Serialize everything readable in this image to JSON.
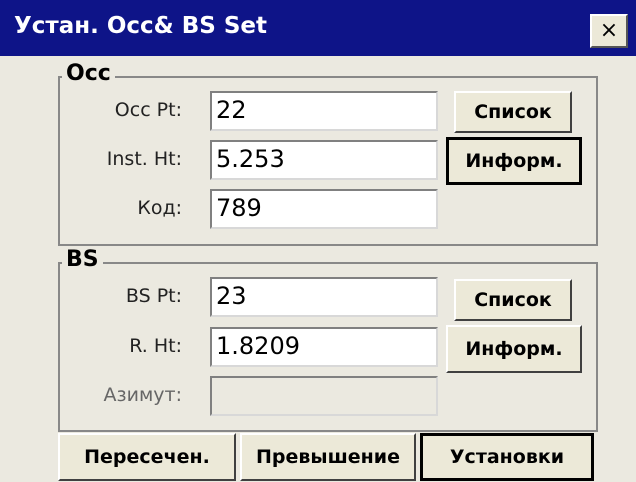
{
  "window": {
    "title": "Устан. Occ& BS Set",
    "close_label": "×"
  },
  "occ": {
    "legend": "Occ",
    "occ_pt_label": "Occ Pt:",
    "occ_pt_value": "22",
    "inst_ht_label": "Inst. Ht:",
    "inst_ht_value": "5.253",
    "code_label": "Код:",
    "code_value": "789",
    "list_button": "Список",
    "info_button": "Информ."
  },
  "bs": {
    "legend": "BS",
    "bs_pt_label": "BS Pt:",
    "bs_pt_value": "23",
    "r_ht_label": "R. Ht:",
    "r_ht_value": "1.8209",
    "azimuth_label": "Азимут:",
    "azimuth_value": "",
    "list_button": "Список",
    "info_button": "Информ."
  },
  "footer": {
    "intersect_button": "Пересечен.",
    "elevation_button": "Превышение",
    "settings_button": "Установки"
  }
}
